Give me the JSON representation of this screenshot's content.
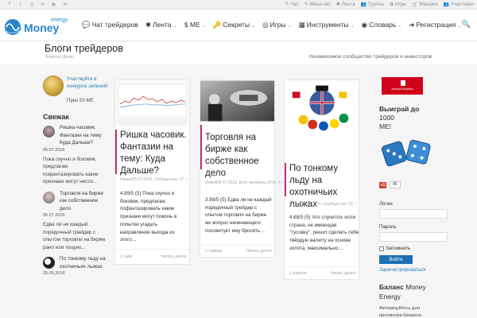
{
  "topbar": {
    "social": [
      "f",
      "t",
      "g",
      "in",
      "▶",
      "✉"
    ],
    "links": [
      {
        "icon": "✎",
        "label": "Чат"
      },
      {
        "icon": "✎",
        "label": "Мини-чат"
      },
      {
        "icon": "✱",
        "label": "Лента"
      },
      {
        "icon": "👥",
        "label": "Группы"
      },
      {
        "icon": "✿",
        "label": "Игры"
      },
      {
        "icon": "🛒",
        "label": "Магазин"
      },
      {
        "icon": "👥",
        "label": "Участники"
      }
    ]
  },
  "logo": {
    "word": "Money",
    "super": "energy"
  },
  "nav": {
    "items": [
      {
        "icon": "💬",
        "label": "Чат трейдеров"
      },
      {
        "icon": "✱",
        "label": "Лента"
      },
      {
        "icon": "$",
        "label": "ME"
      },
      {
        "icon": "🔑",
        "label": "Секреты"
      },
      {
        "icon": "◎",
        "label": "Игры"
      },
      {
        "icon": "▦",
        "label": "Инструменты"
      },
      {
        "icon": "◉",
        "label": "Словарь"
      },
      {
        "icon": "➜",
        "label": "Регистрация"
      }
    ],
    "dropdown_glyph": "⌄",
    "search_glyph": "🔍"
  },
  "page": {
    "title": "Блоги трейдеров",
    "subtitle": "Энергия Денег",
    "tagline": "Независимое сообщество трейдеров и инвесторов."
  },
  "left": {
    "promo_text": "Участвуйте в конкурсе записей!",
    "promo_prize": "Приз 50 МЕ",
    "fresh_title": "Свежак",
    "feed": [
      {
        "title": "Ришка часовик. Фантазии на тему: Куда Дальше?",
        "date": "05.07.2016",
        "excerpt": "Пока скучно и боковик, предлагаю пофантазировать какие признаки могут нести..."
      },
      {
        "title": "Торговля на бирже как собственное дело",
        "date": "05.07.2016",
        "excerpt": "Едва ли не каждый порядочный трейдер с опытом торговли на бирже рано или поздно..."
      },
      {
        "title": "По тонкому льду на охотничьих лыжах",
        "date": "25.06.2016",
        "excerpt": ""
      }
    ]
  },
  "cards": [
    {
      "title": "Ришка часовик. Фантазии на тему: Куда Дальше?",
      "meta": "Ришка05.07.2016, Сообщество, 17 ⚬",
      "excerpt": "4.89/5 (5) Пока скучно и боковик, предлагаю пофантазировать какие признаки могут помочь в попытке угадать направление выхода из этого…",
      "likes": "1 лайк",
      "more": "Читать далее"
    },
    {
      "title": "Торговля на бирже как собственное дело",
      "meta": "Мокей05.07.2016, Блог трейдера 2016, 4 ⚬",
      "excerpt": "3.99/5 (5) Едва ли не каждый порядочный трейдер с опытом торговли на бирже же вопрос начинающего посоветует ему бросить…",
      "likes": "2 лайков",
      "more": "Читать далее"
    },
    {
      "title": "По тонкому льду на охотничьих лыжах",
      "meta": "Мухол25.06.2016, Сообщество, 22 ⚬",
      "excerpt": "4.68/5 (5) Что случится, если страна, не имеющая \"тусовку\", решит сделать себе твёрдую валюту на основе золота, максимально…",
      "likes": "2 лайков",
      "more": "Читать далее"
    }
  ],
  "right": {
    "ad_label": "Альфа-Форекс",
    "win_text": "Выиграй до",
    "win_amount": "1000",
    "win_unit": "ME!",
    "gplus_label": "+1",
    "gplus_count": "45",
    "login_label": "Логин",
    "password_label": "Пароль",
    "remember_label": "Запомнить",
    "login_button": "Войти",
    "register_link": "Зарегистрироваться",
    "balance_title": "Баланс",
    "balance_brand": "Money Energy",
    "balance_note": "Авторизуйтесь для просмотра баланса."
  },
  "colors": {
    "accent": "#c42d7c",
    "link": "#2a7fb8",
    "button": "#1e6fb3",
    "ad": "#d0021b"
  }
}
